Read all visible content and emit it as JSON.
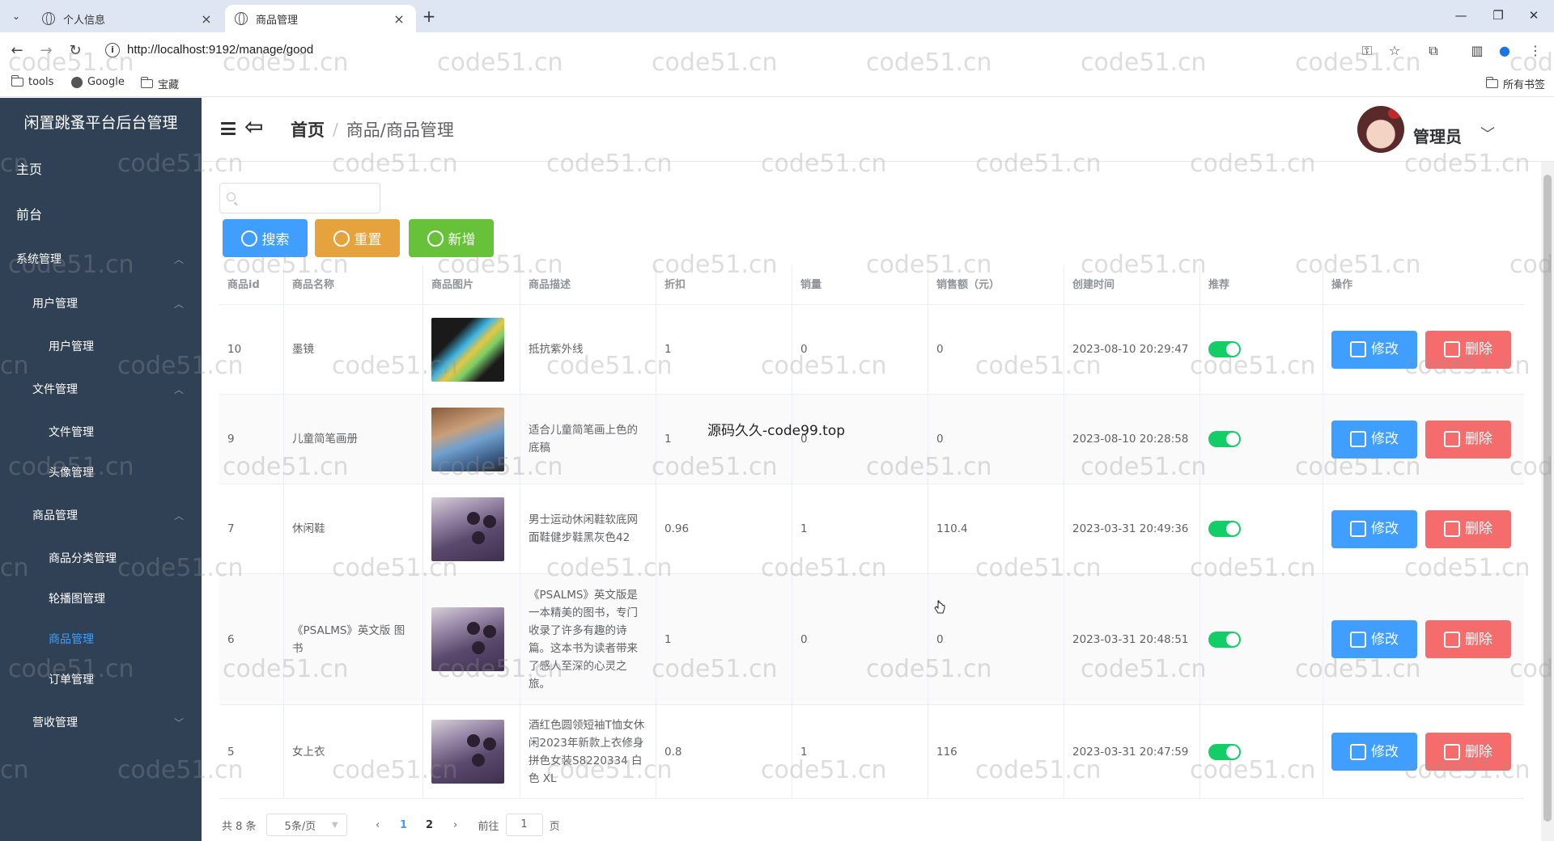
{
  "browser": {
    "tabs": [
      {
        "title": "个人信息",
        "active": false
      },
      {
        "title": "商品管理",
        "active": true
      }
    ],
    "url": "http://localhost:9192/manage/good",
    "bookmarks": [
      "tools",
      "Google",
      "宝藏"
    ],
    "all_bookmarks": "所有书签"
  },
  "sidebar": {
    "title": "闲置跳蚤平台后台管理",
    "items": [
      {
        "label": "主页"
      },
      {
        "label": "前台"
      },
      {
        "label": "系统管理"
      },
      {
        "label": "用户管理"
      },
      {
        "label": "用户管理"
      },
      {
        "label": "文件管理"
      },
      {
        "label": "文件管理"
      },
      {
        "label": "头像管理"
      },
      {
        "label": "商品管理"
      },
      {
        "label": "商品分类管理"
      },
      {
        "label": "轮播图管理"
      },
      {
        "label": "商品管理"
      },
      {
        "label": "订单管理"
      },
      {
        "label": "营收管理"
      }
    ],
    "active_color": "#409eff"
  },
  "header": {
    "breadcrumb_home": "首页",
    "breadcrumb_sep": "/",
    "breadcrumb_current": "商品/商品管理",
    "admin_name": "管理员"
  },
  "search": {
    "placeholder": "",
    "value": ""
  },
  "buttons": {
    "search": "搜索",
    "reset": "重置",
    "add": "新增"
  },
  "table": {
    "headers": [
      "商品id",
      "商品名称",
      "商品图片",
      "商品描述",
      "折扣",
      "销量",
      "销售额（元）",
      "创建时间",
      "推荐",
      "操作"
    ],
    "rows": [
      {
        "id": "10",
        "name": "墨镜",
        "desc": "抵抗紫外线",
        "discount": "1",
        "sales": "0",
        "revenue": "0",
        "created": "2023-08-10  20:29:47",
        "recommend": true
      },
      {
        "id": "9",
        "name": "儿童简笔画册",
        "desc": "适合儿童简笔画上色的底稿",
        "discount": "1",
        "sales": "0",
        "revenue": "0",
        "created": "2023-08-10  20:28:58",
        "recommend": true
      },
      {
        "id": "7",
        "name": "休闲鞋",
        "desc": "男士运动休闲鞋软底网面鞋健步鞋黑灰色42",
        "discount": "0.96",
        "sales": "1",
        "revenue": "110.4",
        "created": "2023-03-31  20:49:36",
        "recommend": true
      },
      {
        "id": "6",
        "name": "《PSALMS》英文版 图书",
        "desc": "《PSALMS》英文版是一本精美的图书，专门收录了许多有趣的诗篇。这本书为读者带来了感人至深的心灵之旅。",
        "discount": "1",
        "sales": "0",
        "revenue": "0",
        "created": "2023-03-31  20:48:51",
        "recommend": true
      },
      {
        "id": "5",
        "name": "女上衣",
        "desc": "酒红色圆领短袖T恤女休闲2023年新款上衣修身拼色女装S8220334 白色 XL",
        "discount": "0.8",
        "sales": "1",
        "revenue": "116",
        "created": "2023-03-31  20:47:59",
        "recommend": true
      }
    ],
    "edit_label": "修改",
    "delete_label": "删除"
  },
  "pagination": {
    "total": "共 8 条",
    "page_size": "5条/页",
    "pages": [
      "1",
      "2"
    ],
    "current": "1",
    "goto_prefix": "前往",
    "goto_value": "1",
    "goto_suffix": "页"
  },
  "overlay": {
    "text": "源码久久-code99.top",
    "watermark": "code51.cn"
  },
  "colors": {
    "primary": "#409eff",
    "warning": "#e6a23c",
    "success": "#67c23a",
    "danger": "#f56c6c",
    "sidebar_bg": "#304156",
    "switch_on": "#13ce66"
  }
}
